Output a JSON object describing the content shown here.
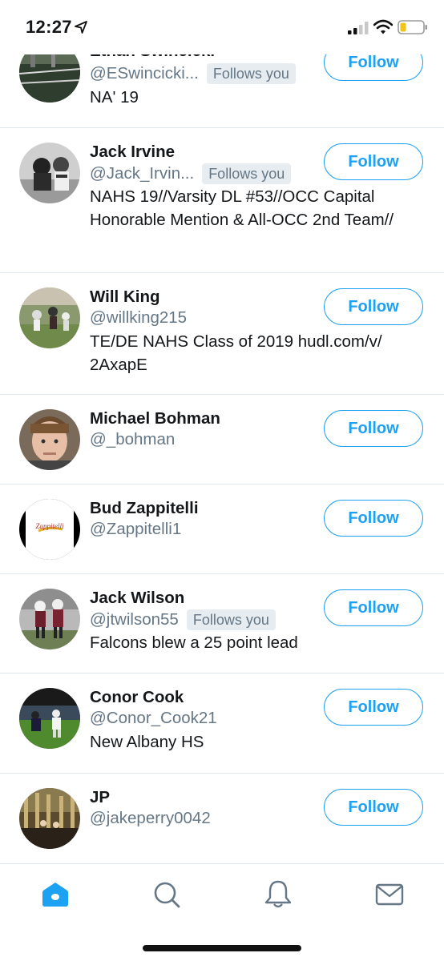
{
  "status_bar": {
    "time": "12:27"
  },
  "users": [
    {
      "name": "Ethan Swincicki",
      "handle": "@ESwincicki...",
      "follows_you": "Follows you",
      "bio": "NA' 19",
      "follow_label": "Follow",
      "avatar_icon": "avatar-photo"
    },
    {
      "name": "Jack Irvine",
      "handle": "@Jack_Irvin...",
      "follows_you": "Follows you",
      "bio": "NAHS 19//Varsity DL #53//OCC Capital Honorable Mention & All-OCC 2nd Team//",
      "follow_label": "Follow",
      "avatar_icon": "avatar-photo"
    },
    {
      "name": "Will King",
      "handle": "@willking215",
      "follows_you": "",
      "bio": "TE/DE NAHS Class of 2019 hudl.com/v/ 2AxapE",
      "follow_label": "Follow",
      "avatar_icon": "avatar-photo"
    },
    {
      "name": "Michael Bohman",
      "handle": "@_bohman",
      "follows_you": "",
      "bio": "",
      "follow_label": "Follow",
      "avatar_icon": "avatar-photo"
    },
    {
      "name": "Bud Zappitelli",
      "handle": "@Zappitelli1",
      "follows_you": "",
      "bio": "",
      "follow_label": "Follow",
      "avatar_icon": "avatar-logo"
    },
    {
      "name": "Jack Wilson",
      "handle": "@jtwilson55",
      "follows_you": "Follows you",
      "bio": "Falcons blew a 25 point lead",
      "follow_label": "Follow",
      "avatar_icon": "avatar-photo"
    },
    {
      "name": "Conor Cook",
      "handle": "@Conor_Cook21",
      "follows_you": "",
      "bio": "New Albany HS",
      "follow_label": "Follow",
      "avatar_icon": "avatar-photo"
    },
    {
      "name": "JP",
      "handle": "@jakeperry0042",
      "follows_you": "",
      "bio": "",
      "follow_label": "Follow",
      "avatar_icon": "avatar-photo"
    }
  ],
  "tab_bar": {
    "tabs": [
      {
        "icon": "home-icon",
        "active": true
      },
      {
        "icon": "search-icon",
        "active": false
      },
      {
        "icon": "bell-icon",
        "active": false
      },
      {
        "icon": "mail-icon",
        "active": false
      }
    ]
  },
  "colors": {
    "accent": "#1da1f2",
    "secondary_text": "#657786",
    "divider": "#e1e8ed"
  }
}
